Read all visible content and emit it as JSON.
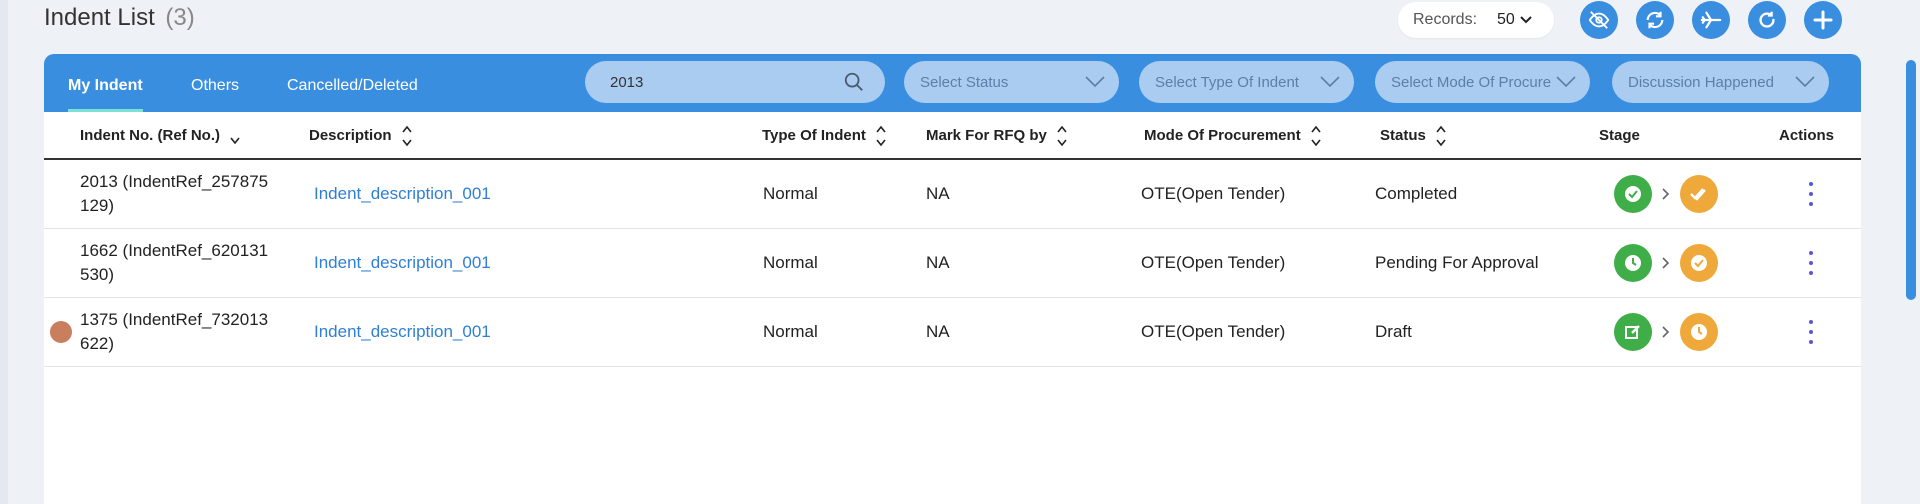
{
  "page": {
    "title": "Indent List",
    "count": "(3)"
  },
  "records": {
    "label": "Records:",
    "value": "50"
  },
  "top_buttons": [
    "eye-off-icon",
    "refresh-icon",
    "plane-icon",
    "reload-icon",
    "add-icon"
  ],
  "tabs": [
    {
      "label": "My Indent",
      "active": true
    },
    {
      "label": "Others",
      "active": false
    },
    {
      "label": "Cancelled/Deleted",
      "active": false
    }
  ],
  "search": {
    "value": "2013"
  },
  "filters": {
    "status": "Select Status",
    "type": "Select Type Of Indent",
    "mode": "Select Mode Of Procure",
    "discussion": "Discussion Happened"
  },
  "columns": {
    "indent_no": "Indent No. (Ref No.)",
    "description": "Description",
    "type": "Type Of Indent",
    "rfq": "Mark For RFQ by",
    "mode": "Mode Of Procurement",
    "status": "Status",
    "stage": "Stage",
    "actions": "Actions"
  },
  "rows": [
    {
      "indent_no": "2013 (IndentRef_257875 129)",
      "description": "Indent_description_001",
      "type": "Normal",
      "rfq": "NA",
      "mode": "OTE(Open Tender)",
      "status": "Completed",
      "stage": [
        "check-circle-icon",
        "double-check-icon"
      ]
    },
    {
      "indent_no": "1662 (IndentRef_620131 530)",
      "description": "Indent_description_001",
      "type": "Normal",
      "rfq": "NA",
      "mode": "OTE(Open Tender)",
      "status": "Pending For Approval",
      "stage": [
        "clock-icon",
        "check-circle-icon"
      ]
    },
    {
      "indent_no": "1375 (IndentRef_732013 622)",
      "description": "Indent_description_001",
      "type": "Normal",
      "rfq": "NA",
      "mode": "OTE(Open Tender)",
      "status": "Draft",
      "stage": [
        "edit-icon",
        "clock-icon"
      ]
    }
  ],
  "colors": {
    "primary": "#3a8ee0",
    "green": "#3fae49",
    "orange": "#efa83a",
    "link": "#2f7fd6"
  }
}
